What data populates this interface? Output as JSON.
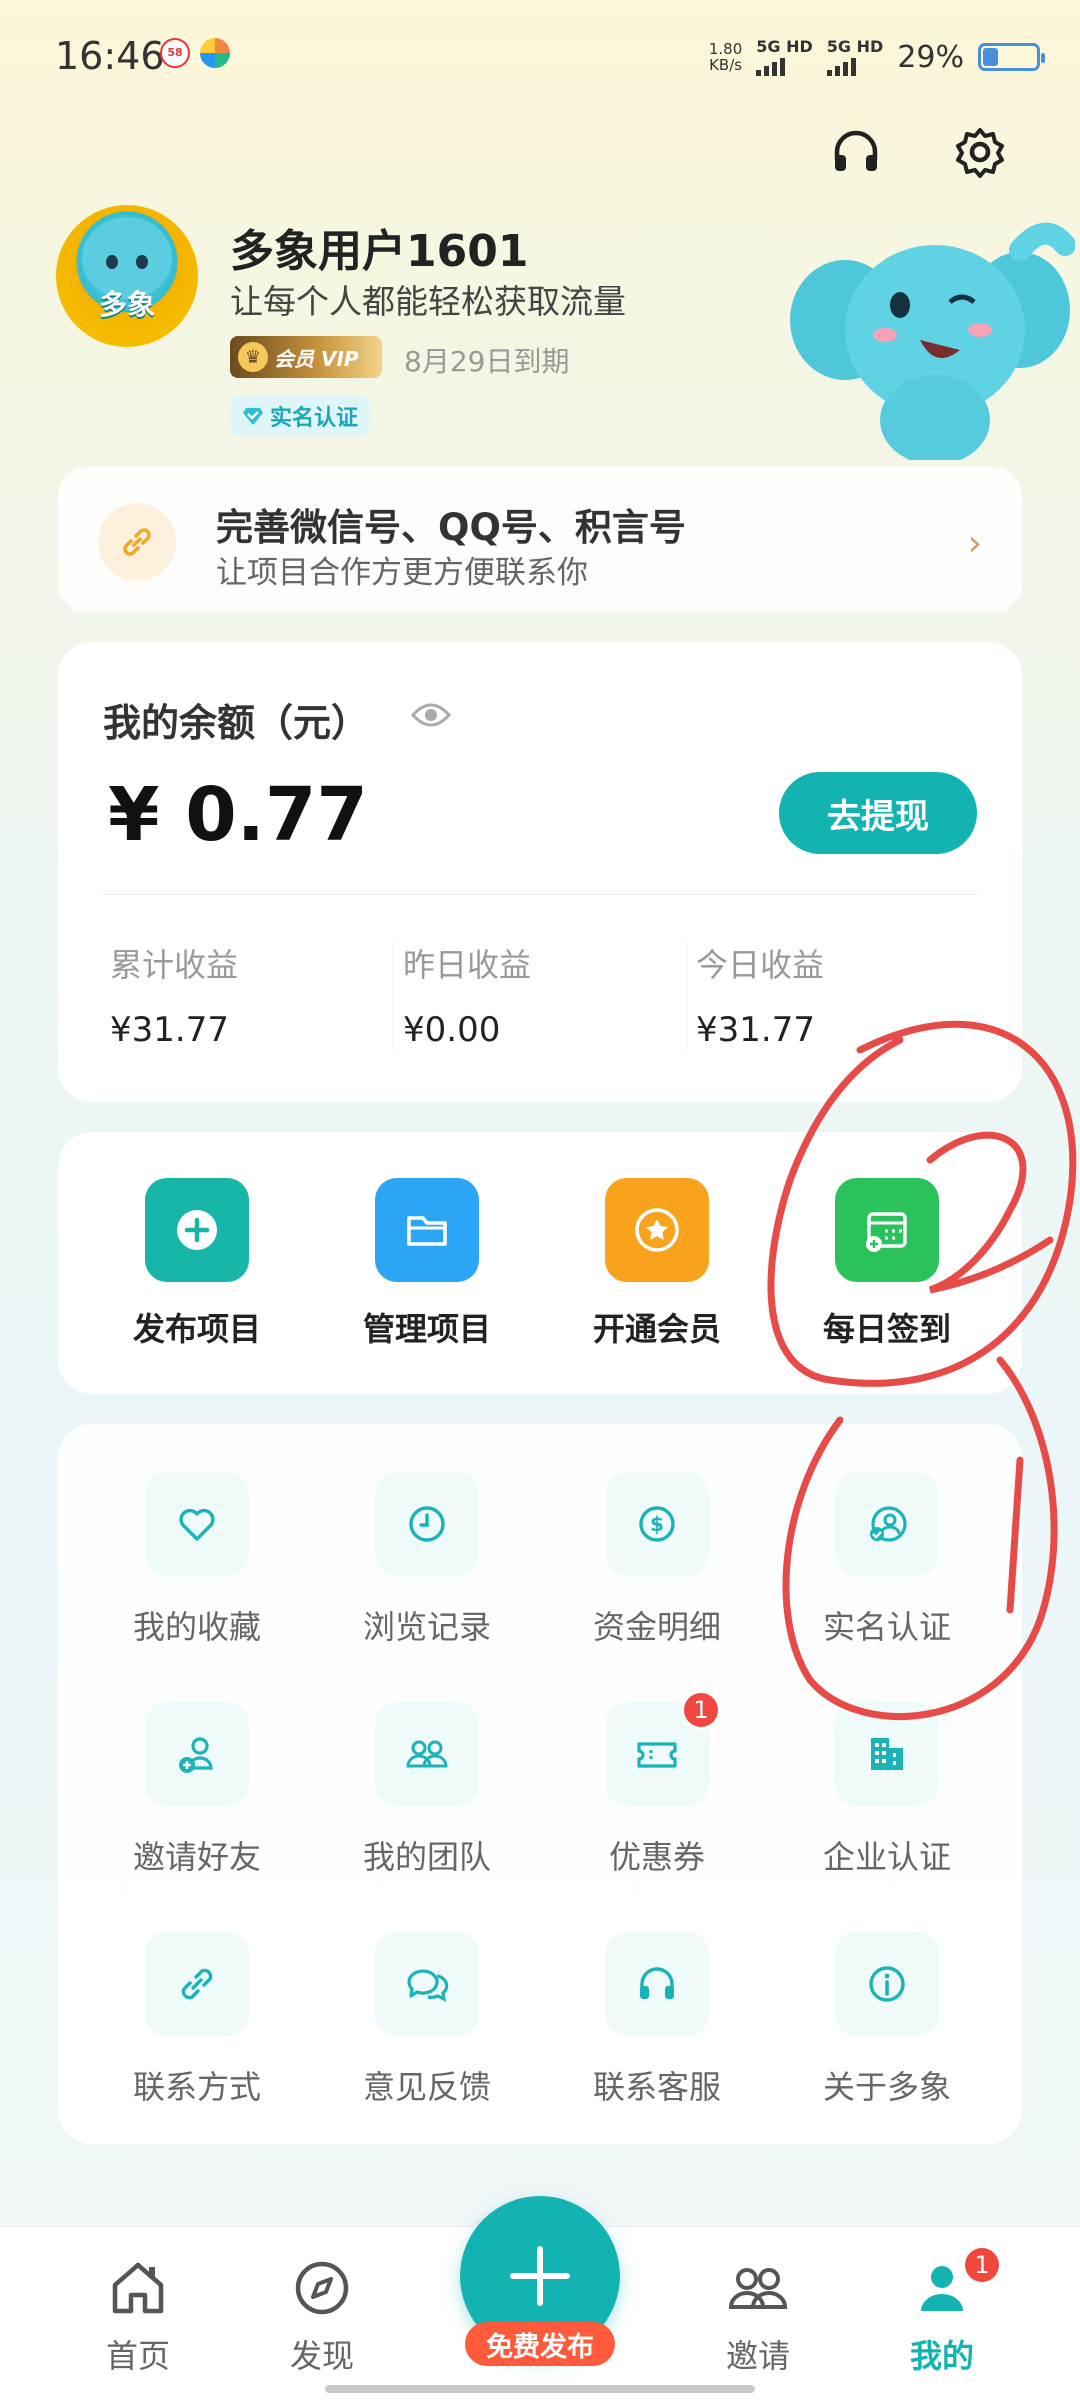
{
  "status_bar": {
    "time": "16:46",
    "net_speed_value": "1.80",
    "net_speed_unit": "KB/s",
    "signal1": "5G HD",
    "signal2": "5G HD",
    "battery": "29%",
    "battery_level": 0.29,
    "app_badge_text": "58"
  },
  "header": {
    "username": "多象用户1601",
    "slogan": "让每个人都能轻松获取流量",
    "vip_label": "会员 VIP",
    "vip_expiry": "8月29日到期",
    "verified_label": "实名认证",
    "avatar_brand": "多象"
  },
  "wechat_banner": {
    "title": "完善微信号、QQ号、积言号",
    "subtitle": "让项目合作方更方便联系你"
  },
  "balance": {
    "label": "我的余额（元）",
    "amount": "¥ 0.77",
    "withdraw_button": "去提现",
    "stats": [
      {
        "label": "累计收益",
        "value": "¥31.77"
      },
      {
        "label": "昨日收益",
        "value": "¥0.00"
      },
      {
        "label": "今日收益",
        "value": "¥31.77"
      }
    ]
  },
  "quick_actions": [
    {
      "label": "发布项目",
      "color": "#17b6a8",
      "icon": "plus-circle-icon"
    },
    {
      "label": "管理项目",
      "color": "#2aa6f5",
      "icon": "folder-icon"
    },
    {
      "label": "开通会员",
      "color": "#f9a21b",
      "icon": "star-badge-icon"
    },
    {
      "label": "每日签到",
      "color": "#2ac25b",
      "icon": "calendar-add-icon"
    }
  ],
  "services": [
    {
      "label": "我的收藏",
      "icon": "heart-icon"
    },
    {
      "label": "浏览记录",
      "icon": "clock-icon"
    },
    {
      "label": "资金明细",
      "icon": "dollar-icon"
    },
    {
      "label": "实名认证",
      "icon": "user-check-icon"
    },
    {
      "label": "邀请好友",
      "icon": "user-add-icon"
    },
    {
      "label": "我的团队",
      "icon": "team-icon"
    },
    {
      "label": "优惠券",
      "icon": "coupon-icon",
      "badge": "1"
    },
    {
      "label": "企业认证",
      "icon": "building-icon"
    },
    {
      "label": "联系方式",
      "icon": "link-icon"
    },
    {
      "label": "意见反馈",
      "icon": "chat-icon"
    },
    {
      "label": "联系客服",
      "icon": "headset-icon"
    },
    {
      "label": "关于多象",
      "icon": "info-icon"
    }
  ],
  "bottom_nav": [
    {
      "label": "首页",
      "icon": "home-icon",
      "active": false
    },
    {
      "label": "发现",
      "icon": "compass-icon",
      "active": false
    },
    {
      "label": "邀请",
      "icon": "people-icon",
      "active": false
    },
    {
      "label": "我的",
      "icon": "person-icon",
      "active": true,
      "badge": "1"
    }
  ],
  "fab": {
    "label": "免费发布"
  },
  "colors": {
    "accent": "#12b3b0",
    "danger": "#f0473e",
    "annotation": "#e64b47"
  },
  "annotations": [
    "2",
    "1"
  ]
}
